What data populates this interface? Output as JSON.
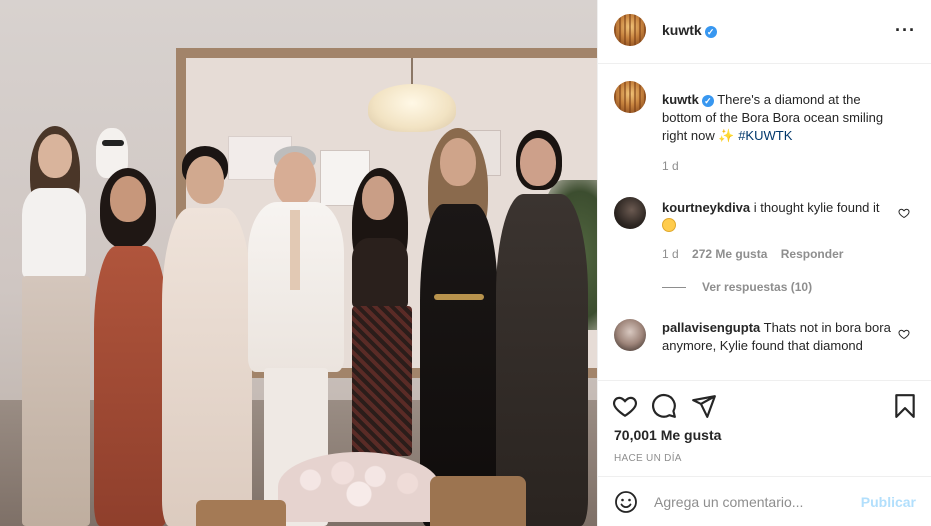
{
  "post": {
    "image_alt": "Seven people posing in front of a talk-show set",
    "username": "kuwtk",
    "verified_badge": "✓",
    "more_label": "···"
  },
  "caption": {
    "username": "kuwtk",
    "text": "There's a diamond at the bottom of the Bora Bora ocean smiling right now",
    "emoji": "✨",
    "hashtag": "#KUWTK",
    "time": "1 d"
  },
  "comments": [
    {
      "username": "kourtneykdiva",
      "text": "i thought kylie found it",
      "emoji": "🙂",
      "time": "1 d",
      "likes": "272 Me gusta",
      "reply_label": "Responder",
      "view_replies": "Ver respuestas (10)"
    },
    {
      "username": "pallavisengupta",
      "text": "Thats not in bora bora anymore, Kylie found that diamond"
    }
  ],
  "actions": {
    "like_icon": "heart-icon",
    "comment_icon": "comment-icon",
    "share_icon": "send-icon",
    "save_icon": "bookmark-icon"
  },
  "likes_count": "70,001 Me gusta",
  "post_date": "HACE UN DÍA",
  "add_comment": {
    "placeholder": "Agrega un comentario...",
    "publish_label": "Publicar"
  },
  "colors": {
    "verified": "#3897f0",
    "publish_disabled": "#b2dffc",
    "hashtag": "#00376b",
    "muted": "#8e8e8e"
  }
}
